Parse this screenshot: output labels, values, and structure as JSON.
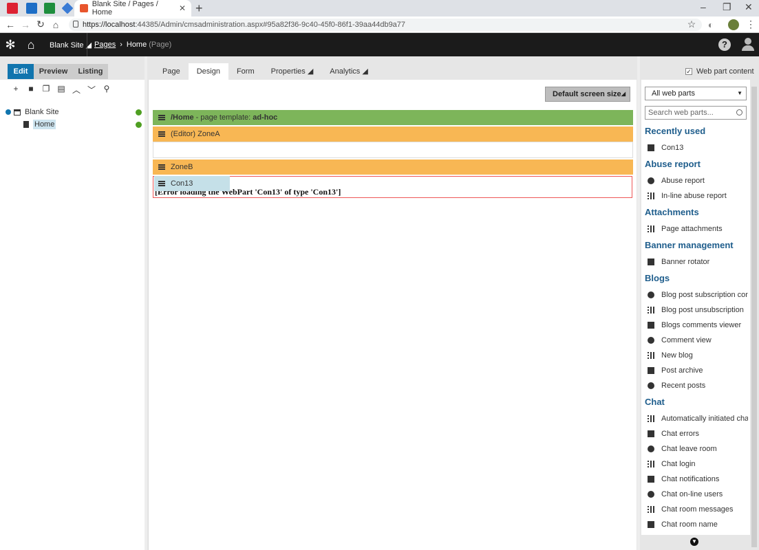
{
  "browser": {
    "tab_title": "Blank Site / Pages / Home",
    "url_host": "https://localhost",
    "url_rest": ":44385/Admin/cmsadministration.aspx#95a82f36-9c40-45f0-86f1-39aa44db9a77"
  },
  "header": {
    "site": "Blank Site",
    "crumb_pages": "Pages",
    "crumb_current": "Home",
    "crumb_type": "(Page)",
    "help": "?"
  },
  "modes": [
    "Edit",
    "Preview",
    "Listing"
  ],
  "tree": {
    "root": "Blank Site",
    "child": "Home"
  },
  "tabs": [
    "Page",
    "Design",
    "Form",
    "Properties",
    "Analytics"
  ],
  "screen_size": "Default screen size",
  "template": {
    "path": "/Home",
    "label": " - page template: ",
    "name": "ad-hoc"
  },
  "zones": {
    "a": "(Editor) ZoneA",
    "b": "ZoneB"
  },
  "webpart": {
    "name": "Con13",
    "error": "[Error loading the WebPart 'Con13' of type 'Con13']"
  },
  "right": {
    "webpart_content": "Web part content",
    "filter": "All web parts",
    "search_placeholder": "Search web parts...",
    "categories": [
      {
        "name": "Recently used",
        "items": [
          "Con13"
        ]
      },
      {
        "name": "Abuse report",
        "items": [
          "Abuse report",
          "In-line abuse report"
        ]
      },
      {
        "name": "Attachments",
        "items": [
          "Page attachments"
        ]
      },
      {
        "name": "Banner management",
        "items": [
          "Banner rotator"
        ]
      },
      {
        "name": "Blogs",
        "items": [
          "Blog post subscription con...",
          "Blog post unsubscription",
          "Blogs comments viewer",
          "Comment view",
          "New blog",
          "Post archive",
          "Recent posts"
        ]
      },
      {
        "name": "Chat",
        "items": [
          "Automatically initiated chat",
          "Chat errors",
          "Chat leave room",
          "Chat login",
          "Chat notifications",
          "Chat on-line users",
          "Chat room messages",
          "Chat room name"
        ]
      }
    ]
  }
}
